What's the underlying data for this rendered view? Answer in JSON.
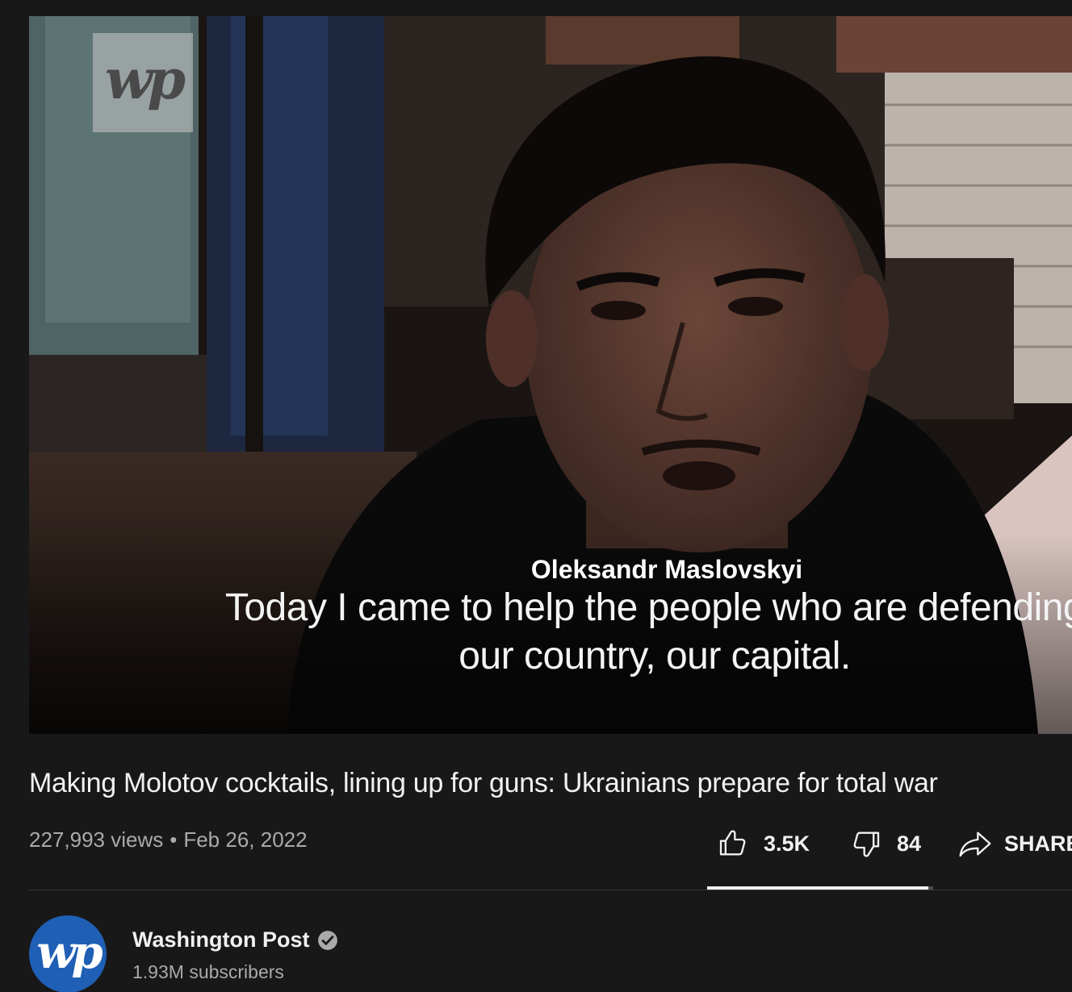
{
  "video": {
    "watermark": "wp",
    "speaker_name": "Oleksandr Maslovskyi",
    "caption_line1": "Today I came to help the people who are defending",
    "caption_line2": "our country, our capital."
  },
  "details": {
    "title": "Making Molotov cocktails, lining up for guns: Ukrainians prepare for total war",
    "views": "227,993 views",
    "separator": "•",
    "date": "Feb 26, 2022"
  },
  "actions": {
    "like_icon": "thumbs-up-icon",
    "like_count": "3.5K",
    "dislike_icon": "thumbs-down-icon",
    "dislike_count": "84",
    "share_icon": "share-arrow-icon",
    "share_label": "SHARE",
    "like_ratio": 0.977
  },
  "channel": {
    "avatar_logo": "wp",
    "name": "Washington Post",
    "verified_icon": "verified-check-icon",
    "subscribers": "1.93M subscribers"
  },
  "colors": {
    "background": "#181818",
    "text_primary": "#f1f1f1",
    "text_secondary": "#aaaaaa",
    "avatar_blue": "#1f5fb5"
  }
}
